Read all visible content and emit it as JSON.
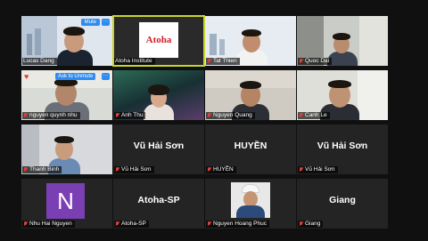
{
  "window": {
    "background": "#101010",
    "active_speaker_color": "#c9d52a"
  },
  "controls": {
    "mute_label": "Mute",
    "more_label": "···",
    "ask_to_unmute_label": "Ask to Unmute"
  },
  "participants": [
    {
      "name": "Lucas Dang",
      "video": true,
      "muted": false,
      "active": false
    },
    {
      "name": "Atoha Institute",
      "video": true,
      "muted": false,
      "active": true,
      "logo_text": "Atoha"
    },
    {
      "name": "Tat Thien",
      "video": true,
      "muted": true,
      "active": false
    },
    {
      "name": "Quoc Dai",
      "video": true,
      "muted": true,
      "active": false
    },
    {
      "name": "nguyen quynh nhu",
      "video": true,
      "muted": true,
      "active": false,
      "reaction": "heart"
    },
    {
      "name": "Anh Thu",
      "video": true,
      "muted": true,
      "active": false
    },
    {
      "name": "Nguyen Quang",
      "video": true,
      "muted": true,
      "active": false
    },
    {
      "name": "Canh Le",
      "video": true,
      "muted": true,
      "active": false
    },
    {
      "name": "Thanh Binh",
      "video": true,
      "muted": true,
      "active": false
    },
    {
      "name": "Vũ Hải Sơn",
      "video": false,
      "muted": true,
      "active": false,
      "display": "Vũ Hải Sơn"
    },
    {
      "name": "HUYỀN",
      "video": false,
      "muted": true,
      "active": false,
      "display": "HUYỀN"
    },
    {
      "name": "Vũ Hải Sơn",
      "video": false,
      "muted": true,
      "active": false,
      "display": "Vũ Hải Sơn"
    },
    {
      "name": "Nhu Hai Nguyen",
      "video": false,
      "muted": true,
      "active": false,
      "avatar_letter": "N"
    },
    {
      "name": "Atoha-SP",
      "video": false,
      "muted": true,
      "active": false,
      "display": "Atoha-SP"
    },
    {
      "name": "Nguyen Hoang Phuc",
      "video": false,
      "muted": true,
      "active": false,
      "profile_photo": true
    },
    {
      "name": "Giang",
      "video": false,
      "muted": true,
      "active": false,
      "display": "Giang"
    }
  ]
}
